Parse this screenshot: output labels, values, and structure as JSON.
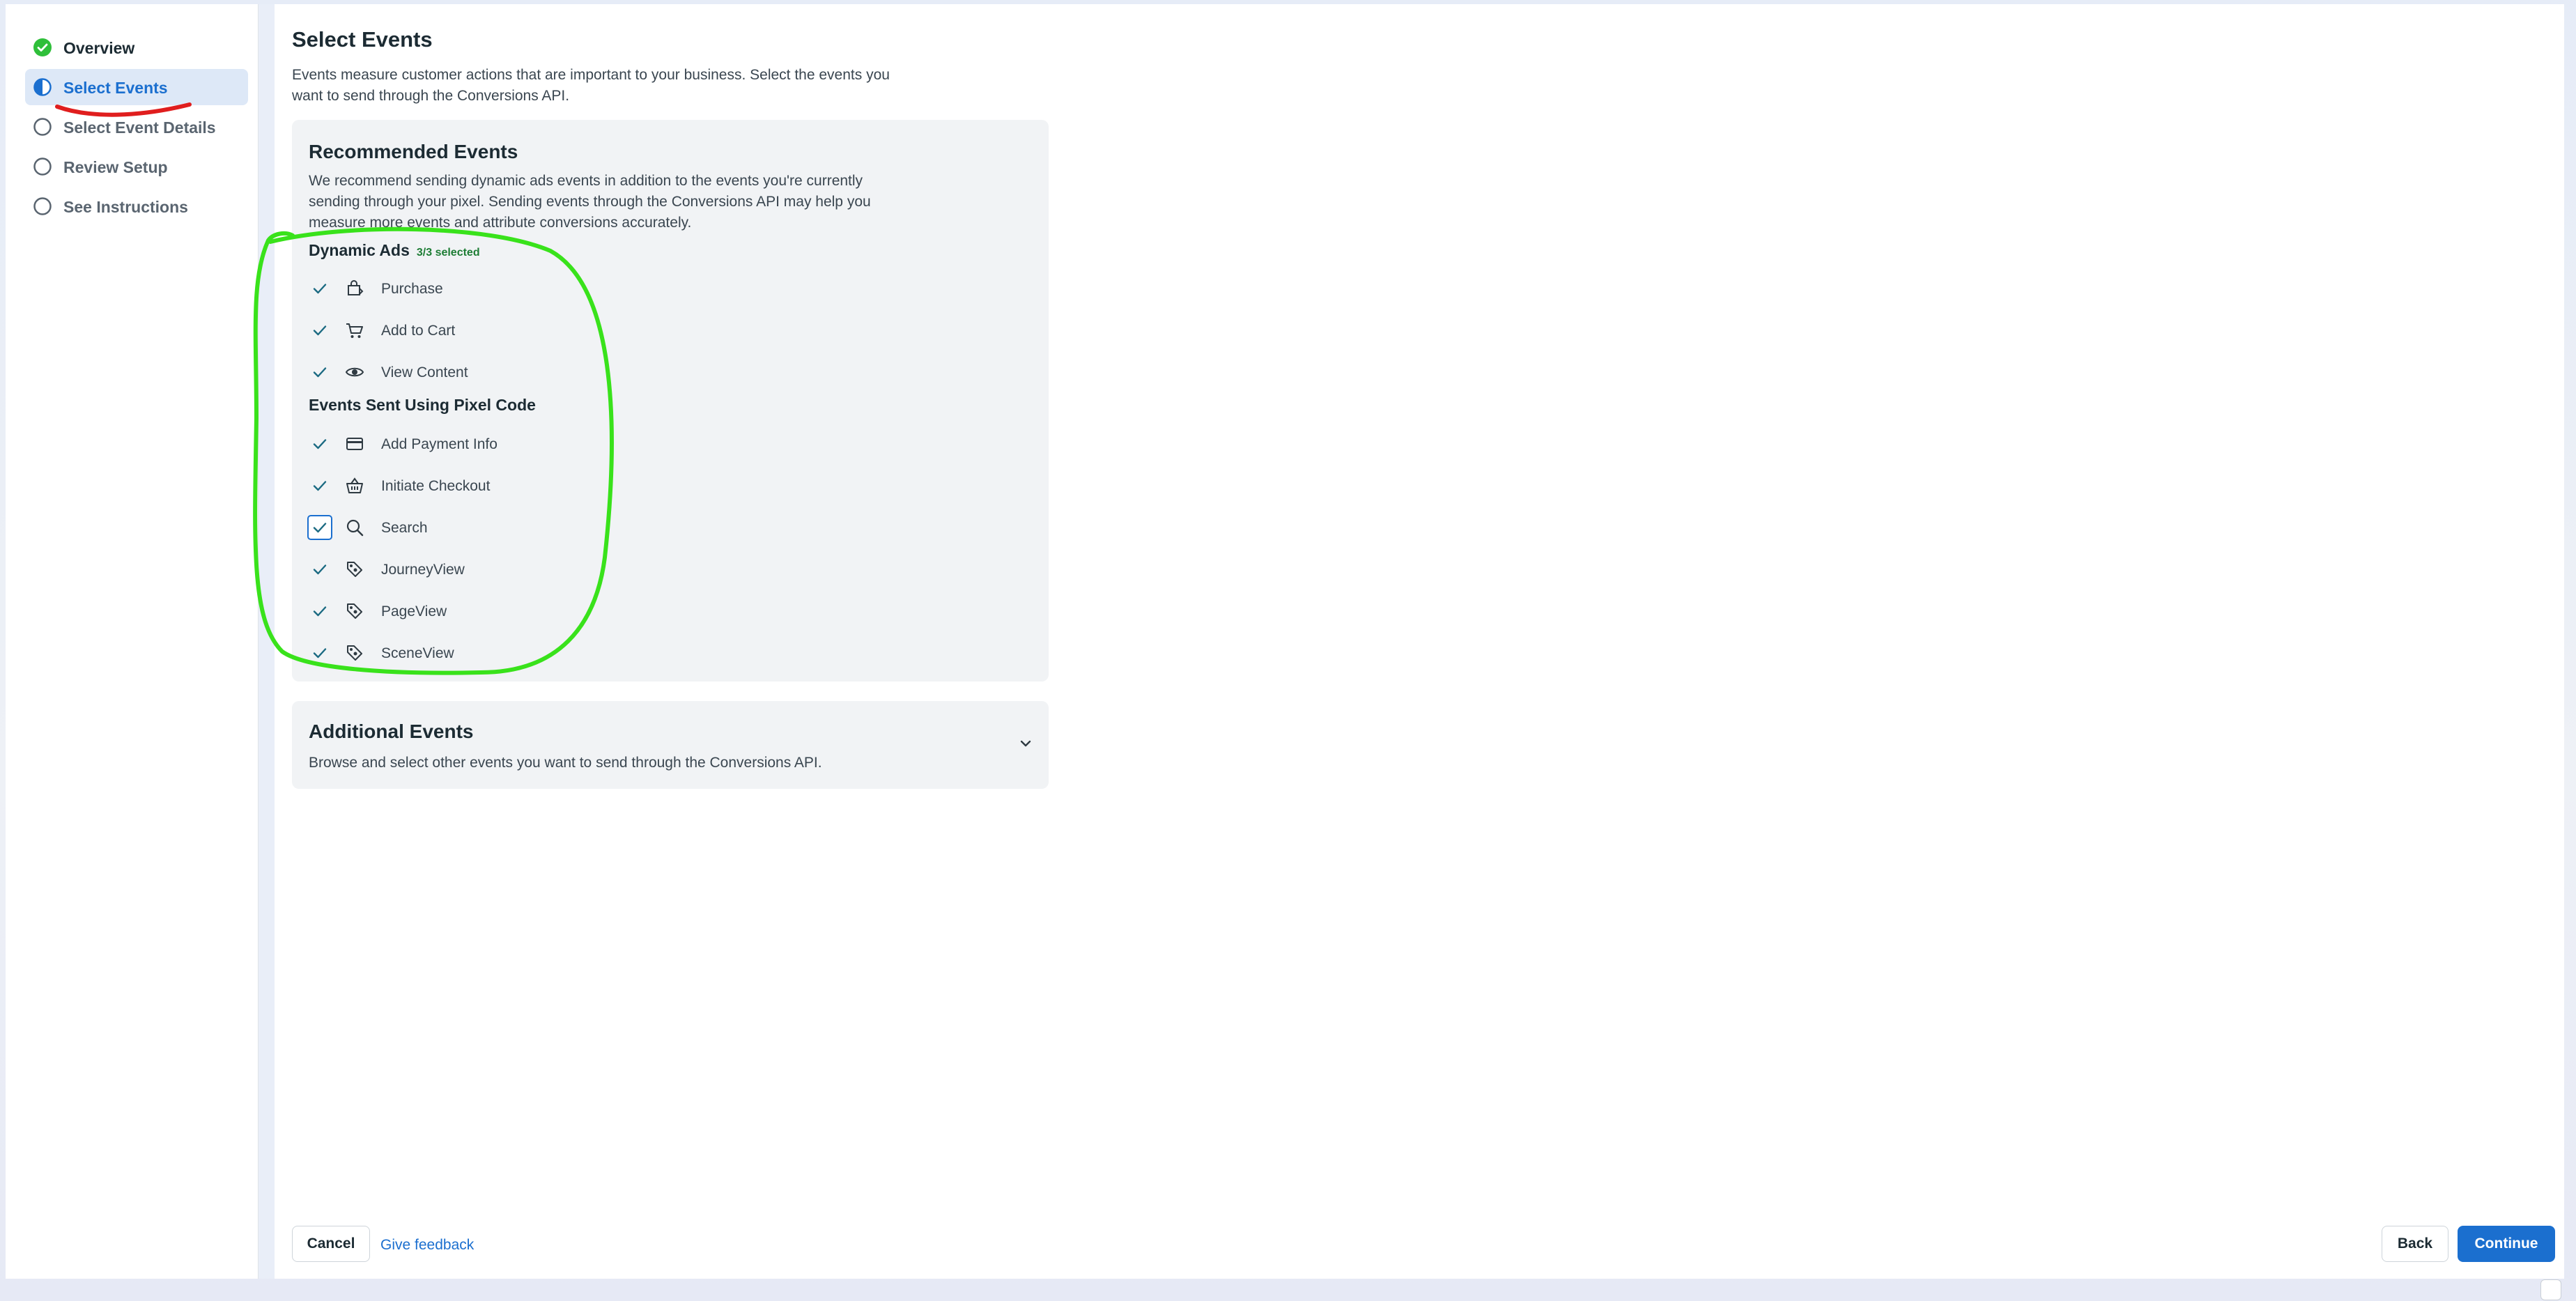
{
  "steps": [
    {
      "label": "Overview",
      "state": "done",
      "icon": "check-circle-icon"
    },
    {
      "label": "Select Events",
      "state": "active",
      "icon": "half-circle-icon"
    },
    {
      "label": "Select Event Details",
      "state": "todo",
      "icon": "empty-circle-icon"
    },
    {
      "label": "Review Setup",
      "state": "todo",
      "icon": "empty-circle-icon"
    },
    {
      "label": "See Instructions",
      "state": "todo",
      "icon": "empty-circle-icon"
    }
  ],
  "page": {
    "title": "Select Events",
    "description": "Events measure customer actions that are important to your business. Select the events you want to send through the Conversions API."
  },
  "recommended": {
    "title": "Recommended Events",
    "description": "We recommend sending dynamic ads events in addition to the events you're currently sending through your pixel. Sending events through the Conversions API may help you measure more events and attribute conversions accurately.",
    "dynamic_ads": {
      "title": "Dynamic Ads",
      "badge": "3/3 selected",
      "events": [
        {
          "label": "Purchase",
          "icon": "shopping-bag-icon",
          "checked": true
        },
        {
          "label": "Add to Cart",
          "icon": "cart-icon",
          "checked": true
        },
        {
          "label": "View Content",
          "icon": "eye-icon",
          "checked": true
        }
      ]
    },
    "pixel_code": {
      "title": "Events Sent Using Pixel Code",
      "events": [
        {
          "label": "Add Payment Info",
          "icon": "credit-card-icon",
          "checked": true
        },
        {
          "label": "Initiate Checkout",
          "icon": "basket-icon",
          "checked": true
        },
        {
          "label": "Search",
          "icon": "search-icon",
          "checked": true,
          "focused": true
        },
        {
          "label": "JourneyView",
          "icon": "tag-icon",
          "checked": true
        },
        {
          "label": "PageView",
          "icon": "tag-icon",
          "checked": true
        },
        {
          "label": "SceneView",
          "icon": "tag-icon",
          "checked": true
        }
      ]
    }
  },
  "additional": {
    "title": "Additional Events",
    "description": "Browse and select other events you want to send through the Conversions API."
  },
  "footer": {
    "cancel_label": "Cancel",
    "feedback_label": "Give feedback",
    "back_label": "Back",
    "continue_label": "Continue"
  },
  "colors": {
    "accent": "#1b6fcf",
    "success": "#2fbf3a",
    "badge_green": "#1e7d35",
    "annotation_red": "#e01e1e",
    "annotation_green": "#39e21b"
  }
}
